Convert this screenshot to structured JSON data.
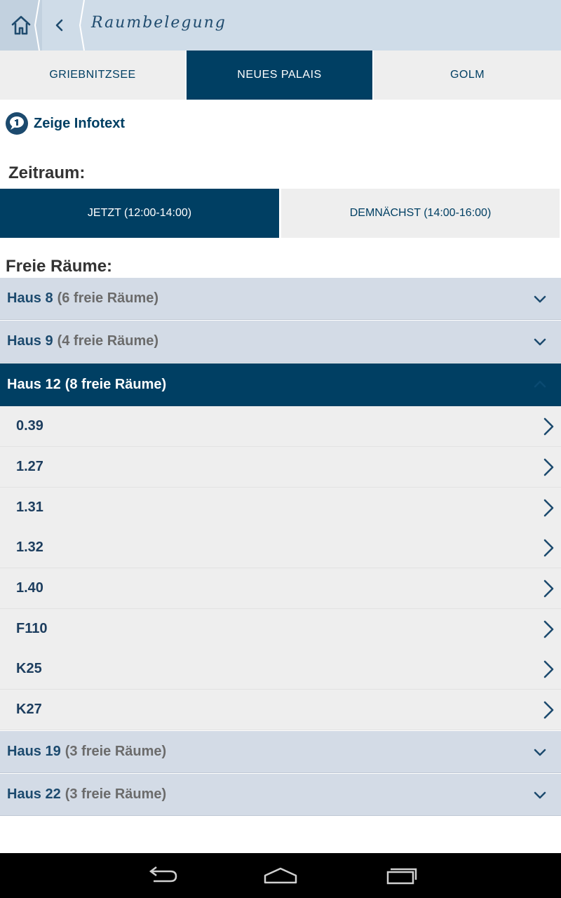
{
  "header": {
    "title": "Raumbelegung",
    "home_icon": "home-icon",
    "back_icon": "chevron-left-icon"
  },
  "campus_tabs": [
    {
      "label": "GRIEBNITZSEE",
      "selected": false
    },
    {
      "label": "NEUES PALAIS",
      "selected": true
    },
    {
      "label": "GOLM",
      "selected": false
    }
  ],
  "info": {
    "icon": "info-bubble-icon",
    "label": "Zeige Infotext"
  },
  "timeframe": {
    "label": "Zeitraum:",
    "now_label": "JETZT (12:00-14:00)",
    "soon_label": "DEMNÄCHST (14:00-16:00)"
  },
  "free_rooms": {
    "label": "Freie Räume:",
    "houses": [
      {
        "name": "Haus 8",
        "count": "(6 freie Räume)",
        "expanded": false
      },
      {
        "name": "Haus 9",
        "count": "(4 freie Räume)",
        "expanded": false
      },
      {
        "name": "Haus 12",
        "count": "(8 freie Räume)",
        "expanded": true
      },
      {
        "name": "Haus 19",
        "count": "(3 freie Räume)",
        "expanded": false
      },
      {
        "name": "Haus 22",
        "count": "(3 freie Räume)",
        "expanded": false
      }
    ],
    "rooms": [
      "0.39",
      "1.27",
      "1.31",
      "1.32",
      "1.40",
      "F110",
      "K25",
      "K27"
    ]
  },
  "colors": {
    "primary": "#003f63",
    "header_bg": "#cfdce8",
    "house_bg": "#d3dbe6",
    "room_bg": "#eeeeee"
  },
  "navbar": {
    "icons": [
      "back-icon",
      "home-icon",
      "recent-apps-icon"
    ]
  }
}
